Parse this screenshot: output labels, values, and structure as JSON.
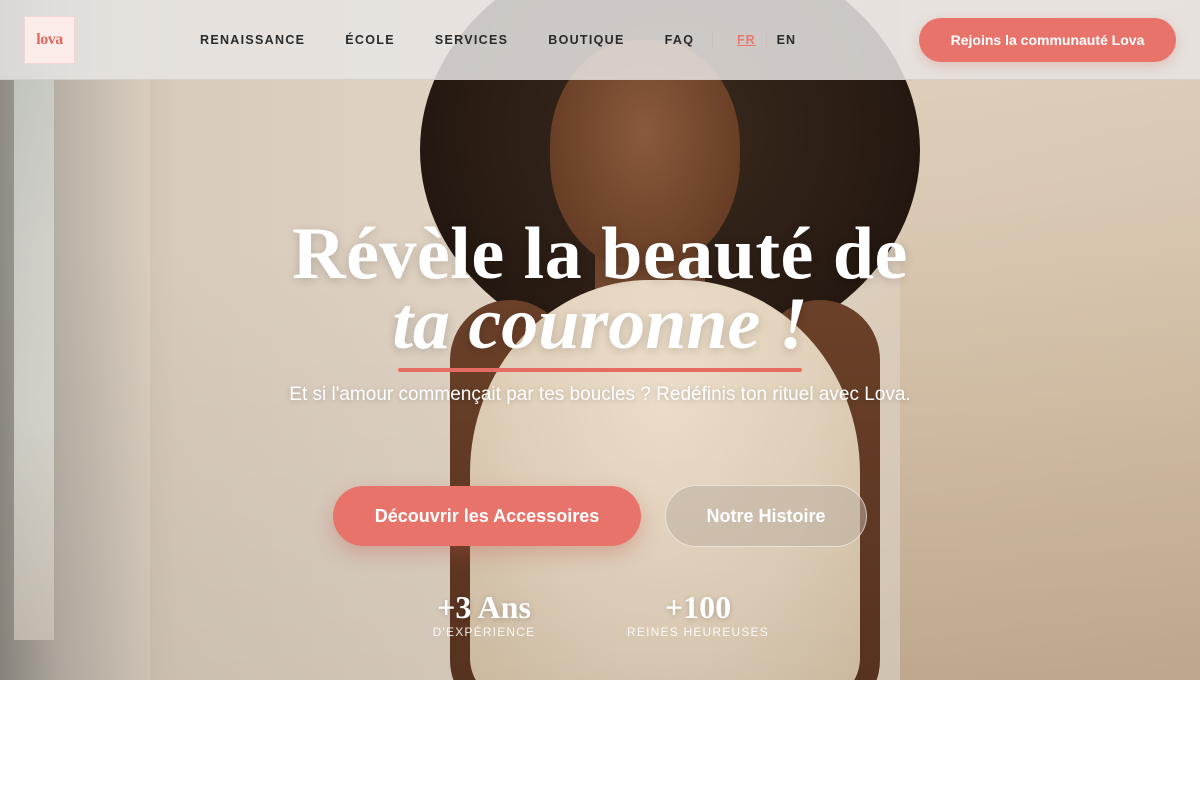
{
  "brand": {
    "logo_text": "lova",
    "accent_color": "#e8736a"
  },
  "nav": {
    "links": [
      {
        "label": "RENAISSANCE"
      },
      {
        "label": "ÉCOLE"
      },
      {
        "label": "SERVICES"
      },
      {
        "label": "BOUTIQUE"
      },
      {
        "label": "FAQ"
      }
    ],
    "languages": {
      "active": "FR",
      "other": "EN"
    },
    "cta_label": "Rejoins la communauté Lova"
  },
  "hero": {
    "headline_line1": "Révèle la beauté de",
    "headline_line2": "ta couronne !",
    "subtitle": "Et si l'amour commençait par tes boucles ? Redéfinis ton rituel avec Lova.",
    "primary_button": "Découvrir les Accessoires",
    "secondary_button": "Notre Histoire",
    "stats": [
      {
        "value": "+3 Ans",
        "label": "D'EXPÉRIENCE"
      },
      {
        "value": "+100",
        "label": "REINES HEUREUSES"
      }
    ]
  }
}
